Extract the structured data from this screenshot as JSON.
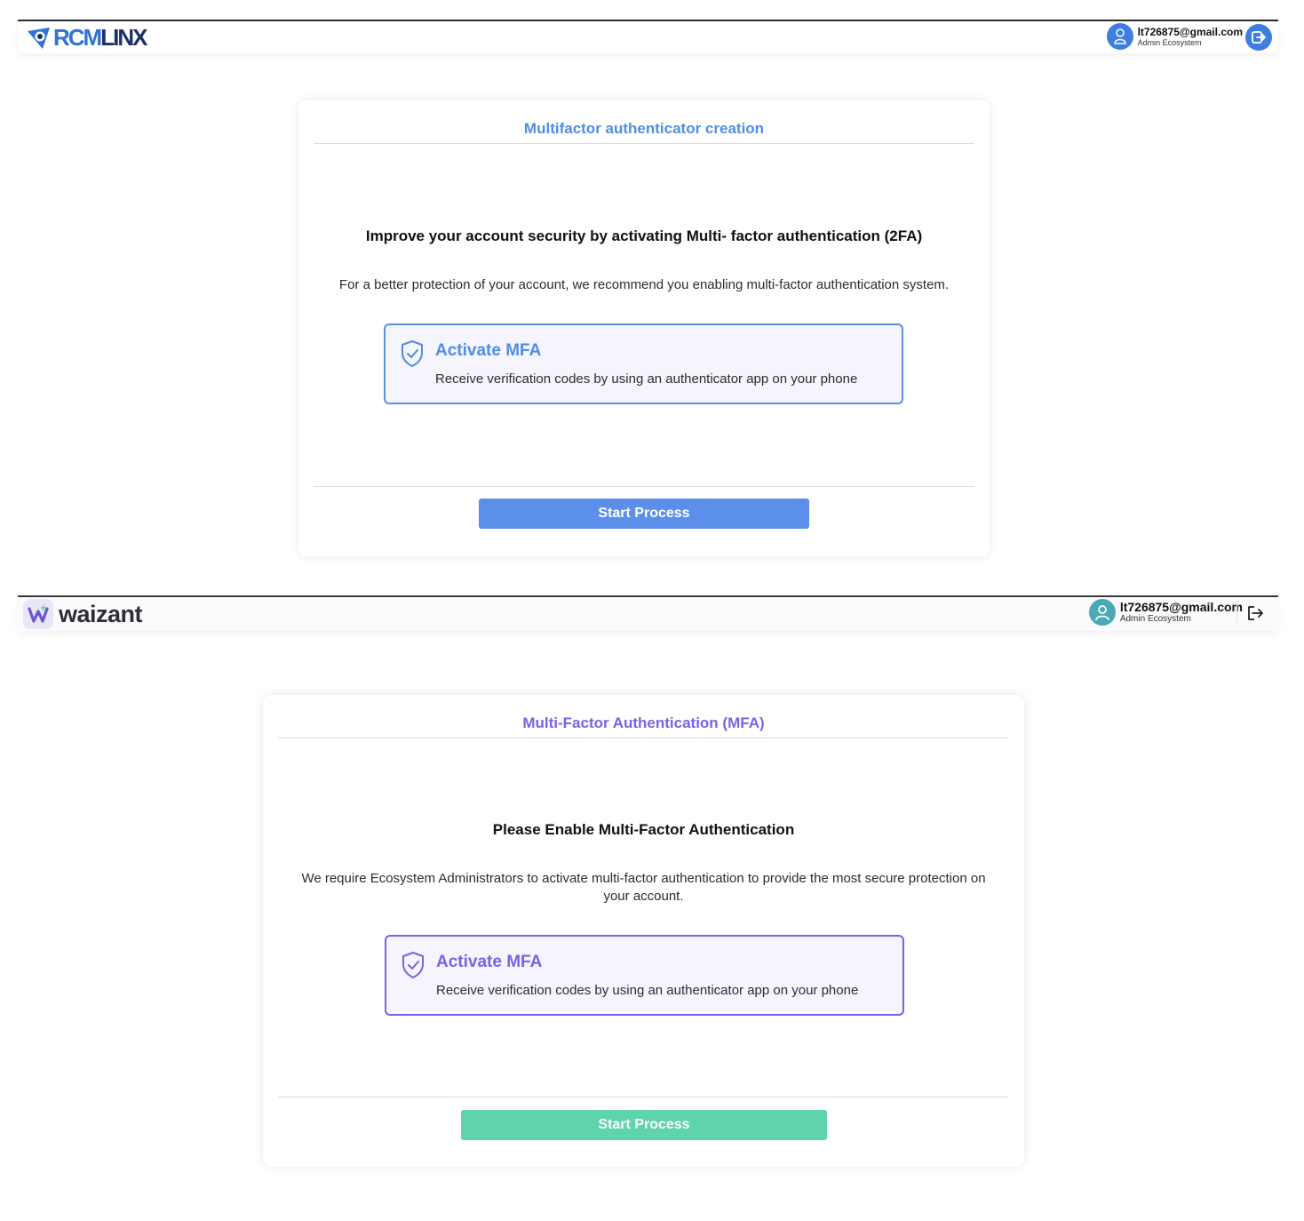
{
  "screen_a": {
    "brand": {
      "logo_part1": "RCM",
      "logo_part2": "LINX",
      "accent_color": "#4f8ee6"
    },
    "user": {
      "email": "lt726875@gmail.com",
      "role": "Admin Ecosystem",
      "avatar_icon": "user-icon",
      "logout_icon": "logout-icon"
    },
    "card": {
      "title": "Multifactor authenticator creation",
      "headline": "Improve your account security by activating Multi- factor authentication (2FA)",
      "description": "For a better protection of your account, we recommend you enabling multi-factor authentication system.",
      "option": {
        "icon": "shield-check-icon",
        "title": "Activate MFA",
        "description": "Receive verification codes by using an authenticator app on your phone"
      },
      "button_label": "Start Process",
      "button_color": "#5b8fea"
    }
  },
  "screen_b": {
    "brand": {
      "logo_text": "waizant",
      "accent_color": "#7a62e6"
    },
    "user": {
      "email": "lt726875@gmail.com",
      "role": "Admin Ecosystem",
      "avatar_icon": "user-icon",
      "logout_icon": "logout-icon"
    },
    "card": {
      "title": "Multi-Factor Authentication (MFA)",
      "headline": "Please Enable Multi-Factor Authentication",
      "description": "We require Ecosystem Administrators to activate multi-factor authentication to provide the most secure protection on your account.",
      "option": {
        "icon": "shield-check-icon",
        "title": "Activate MFA",
        "description": "Receive verification codes by using an authenticator app on your phone"
      },
      "button_label": "Start Process",
      "button_color": "#5fd3a9"
    }
  }
}
